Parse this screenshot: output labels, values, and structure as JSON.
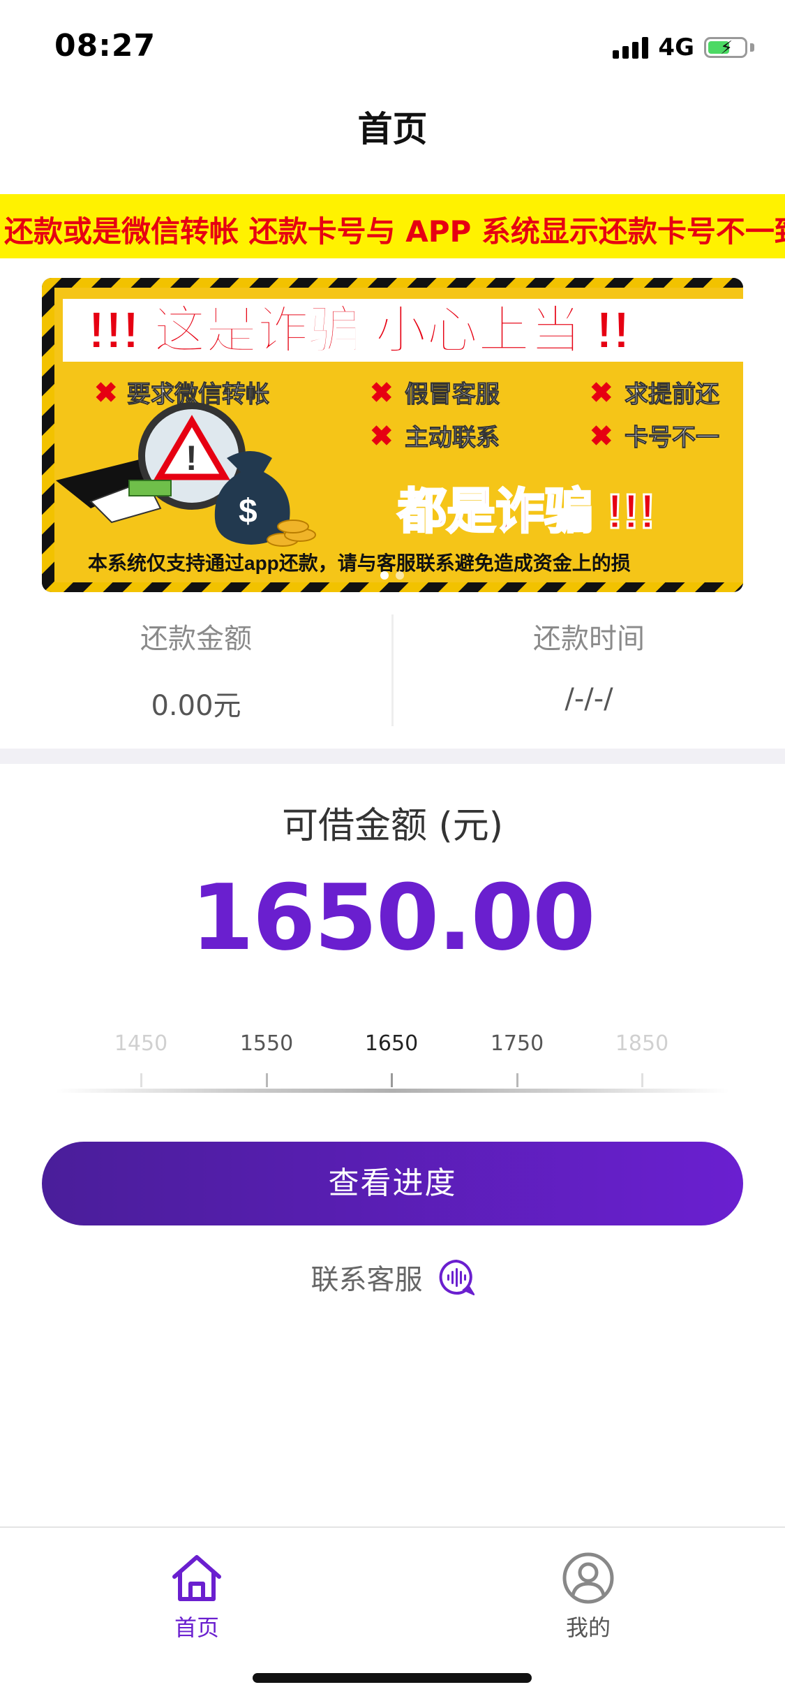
{
  "status_bar": {
    "time": "08:27",
    "network": "4G",
    "battery_level": 0.5,
    "charging": true
  },
  "nav": {
    "title": "首页"
  },
  "marquee": {
    "text": "还款或是微信转帐 还款卡号与 APP 系统显示还款卡号不一致"
  },
  "banner": {
    "headline": "!!! 这是诈骗 小心上当 !!",
    "items": [
      "要求微信转帐",
      "假冒客服",
      "求提前还",
      "主动联系",
      "卡号不一"
    ],
    "warning": "都是诈骗 !!!",
    "footer": "本系统仅支持通过app还款，请与客服联系避免造成资金上的损",
    "slide_count": 2,
    "active_slide": 0
  },
  "repay": {
    "amount_label": "还款金额",
    "amount_value": "0.00元",
    "time_label": "还款时间",
    "time_value": "/-/-/"
  },
  "loan": {
    "label": "可借金额 (元)",
    "amount": "1650.00",
    "ruler": {
      "ticks": [
        "1450",
        "1550",
        "1650",
        "1750",
        "1850"
      ],
      "selected": "1650"
    }
  },
  "actions": {
    "progress_button": "查看进度",
    "contact_label": "联系客服"
  },
  "tabbar": {
    "home_label": "首页",
    "mine_label": "我的",
    "active": "home"
  },
  "colors": {
    "accent": "#6a1fcf",
    "button_start": "#4a1e9a",
    "button_end": "#6a1fd0",
    "marquee_bg": "#fff200",
    "marquee_text": "#e60012"
  }
}
